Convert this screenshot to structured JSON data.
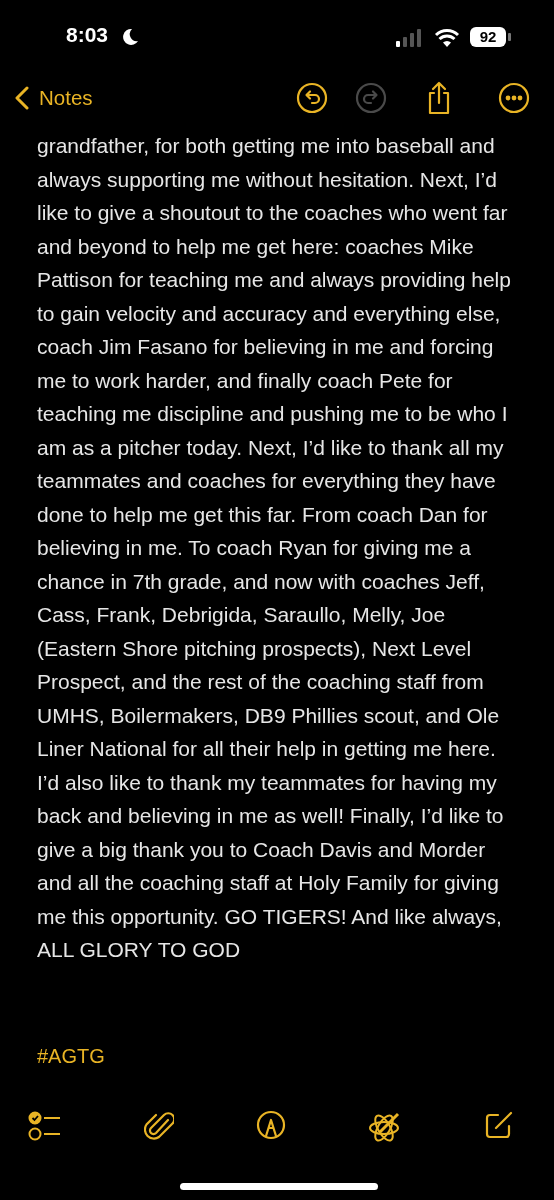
{
  "status_bar": {
    "time": "8:03",
    "battery": "92"
  },
  "nav": {
    "back_label": "Notes",
    "actions": [
      {
        "kind": "undo",
        "disabled": false
      },
      {
        "kind": "redo",
        "disabled": true
      }
    ]
  },
  "note": {
    "body": "grandfather, for both getting me into baseball and always supporting me without hesitation. Next, I’d like to give a shoutout to the coaches who went far and beyond to help me get here: coaches Mike Pattison for teaching me and always providing help to gain velocity and accuracy and everything else, coach Jim Fasano for believing in me and forcing me to work harder, and finally coach Pete for teaching me discipline and pushing me to be who I am as a pitcher today. Next, I’d like to thank all my teammates and coaches for everything they have done to help me get this far. From coach Dan for believing in me. To coach Ryan for giving me a chance in 7th grade, and now with coaches Jeff, Cass, Frank, Debrigida, Saraullo, Melly, Joe (Eastern Shore pitching prospects), Next Level Prospect, and the rest of the coaching staff from UMHS, Boilermakers, DB9 Phillies scout, and Ole Liner National for all their help in getting me here. I’d also like to thank my teammates for having my back and believing in me as well! Finally, I’d like to give a big thank you to Coach Davis and Morder and all the coaching staff at Holy Family for giving me this opportunity. GO TIGERS! And like always, ALL GLORY TO GOD",
    "hashtag": "#AGTG"
  }
}
